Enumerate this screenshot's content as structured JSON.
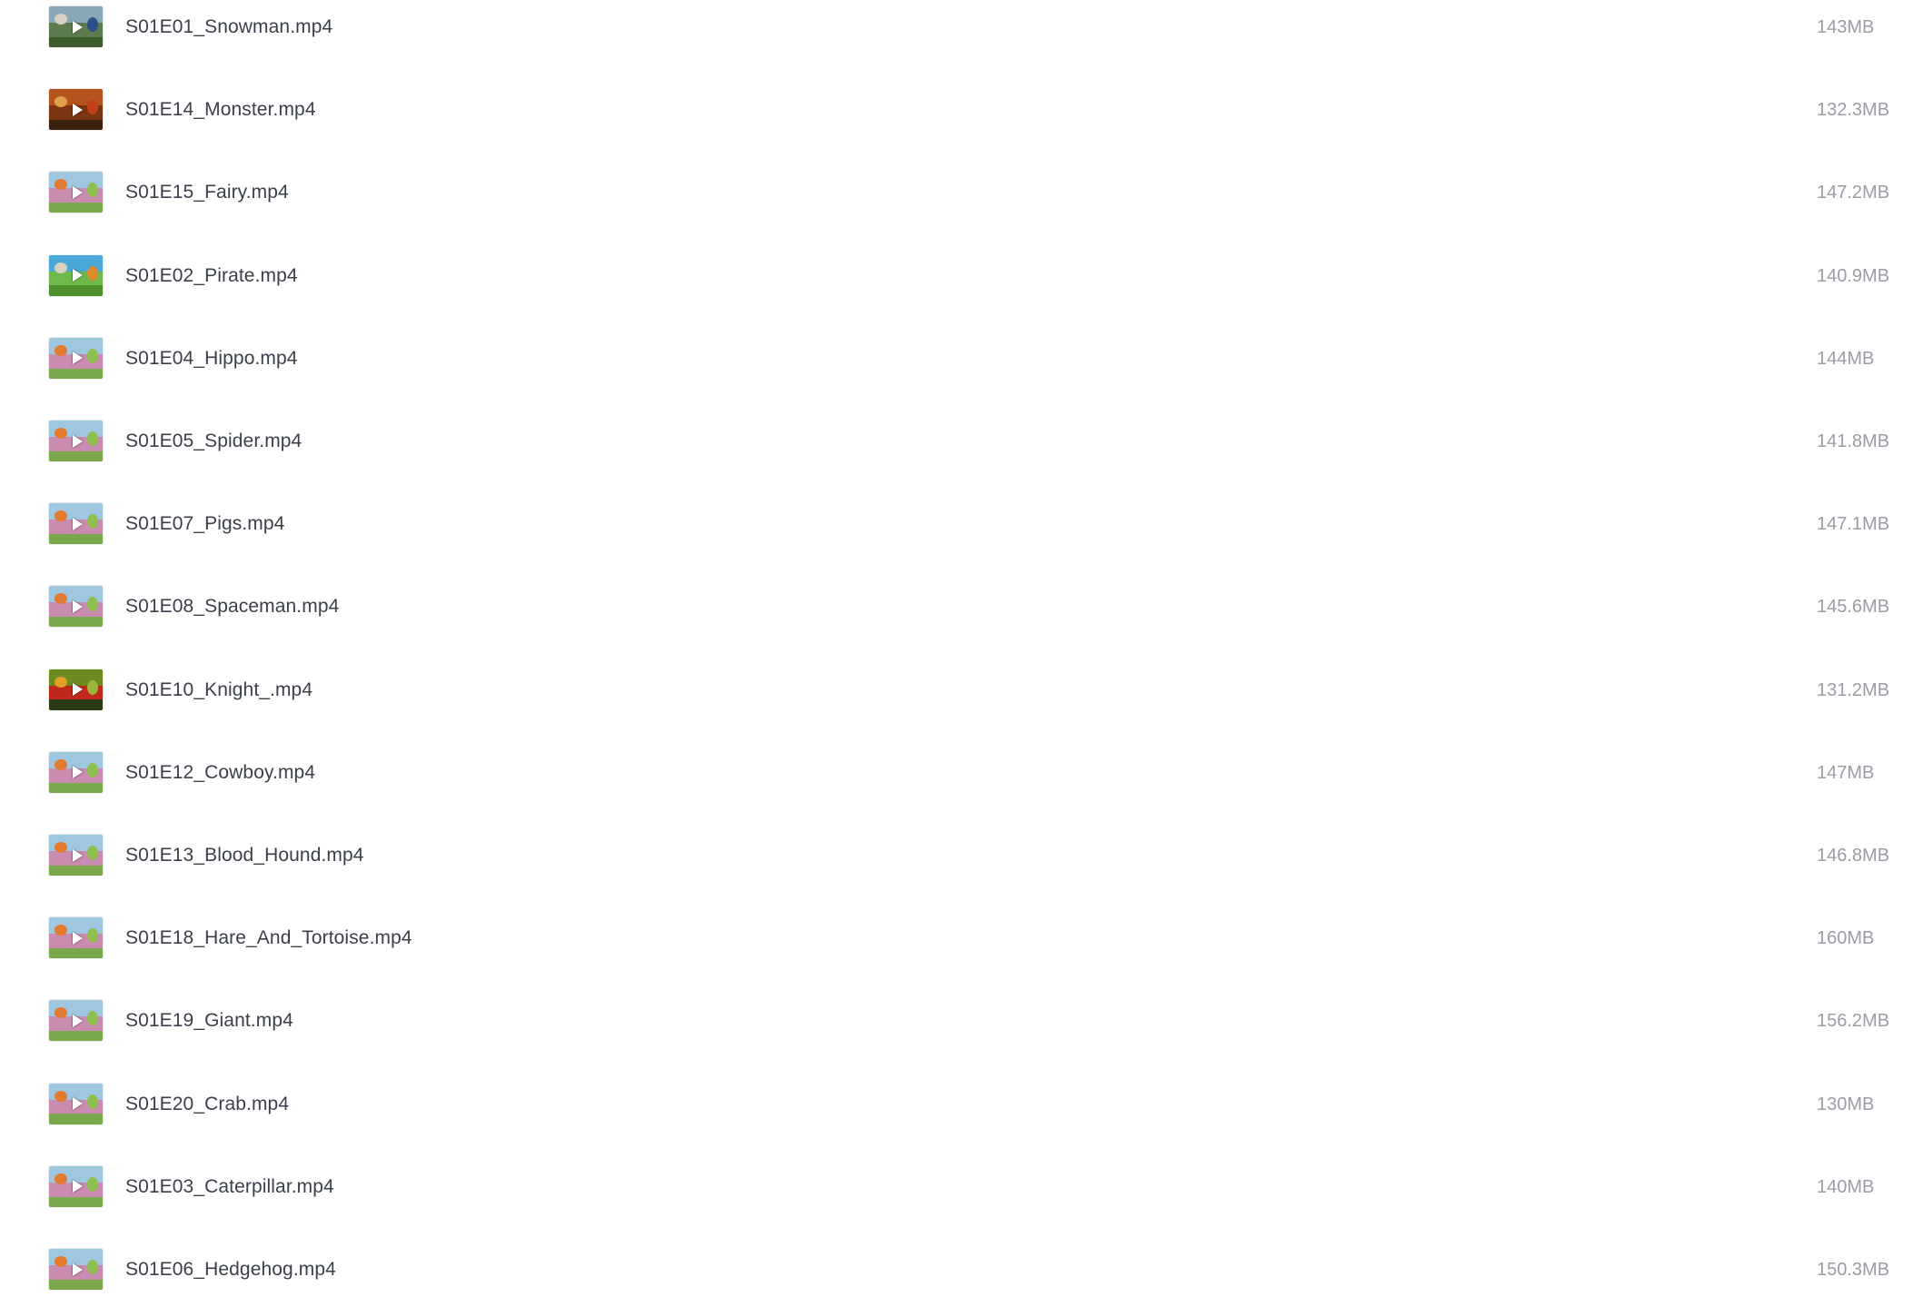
{
  "files": [
    {
      "name": "S01E01_Snowman.mp4",
      "size": "143MB",
      "icon": "play-icon",
      "thumb": {
        "sky": "#8aa7b8",
        "mid": "#5d7a4e",
        "ground": "#3c5a2c",
        "a": "#d8d0c4",
        "b": "#2b4f8a"
      }
    },
    {
      "name": "S01E14_Monster.mp4",
      "size": "132.3MB",
      "icon": "play-icon",
      "thumb": {
        "sky": "#b4531d",
        "mid": "#7a3412",
        "ground": "#3b2110",
        "a": "#e3a04a",
        "b": "#c2401b"
      }
    },
    {
      "name": "S01E15_Fairy.mp4",
      "size": "147.2MB",
      "icon": "play-icon",
      "thumb": {
        "sky": "#9fc7df",
        "mid": "#c98bb0",
        "ground": "#7aa84c",
        "a": "#e27a2f",
        "b": "#8fbf4d"
      }
    },
    {
      "name": "S01E02_Pirate.mp4",
      "size": "140.9MB",
      "icon": "play-icon",
      "thumb": {
        "sky": "#49a8d8",
        "mid": "#6fb84a",
        "ground": "#4f8f2d",
        "a": "#d9d2bf",
        "b": "#e08a2e"
      }
    },
    {
      "name": "S01E04_Hippo.mp4",
      "size": "144MB",
      "icon": "play-icon",
      "thumb": {
        "sky": "#9fc7df",
        "mid": "#c98bb0",
        "ground": "#7aa84c",
        "a": "#e27a2f",
        "b": "#8fbf4d"
      }
    },
    {
      "name": "S01E05_Spider.mp4",
      "size": "141.8MB",
      "icon": "play-icon",
      "thumb": {
        "sky": "#9fc7df",
        "mid": "#c98bb0",
        "ground": "#7aa84c",
        "a": "#e27a2f",
        "b": "#8fbf4d"
      }
    },
    {
      "name": "S01E07_Pigs.mp4",
      "size": "147.1MB",
      "icon": "play-icon",
      "thumb": {
        "sky": "#9fc7df",
        "mid": "#c98bb0",
        "ground": "#7aa84c",
        "a": "#e27a2f",
        "b": "#8fbf4d"
      }
    },
    {
      "name": "S01E08_Spaceman.mp4",
      "size": "145.6MB",
      "icon": "play-icon",
      "thumb": {
        "sky": "#9fc7df",
        "mid": "#c98bb0",
        "ground": "#7aa84c",
        "a": "#e27a2f",
        "b": "#8fbf4d"
      }
    },
    {
      "name": "S01E10_Knight_.mp4",
      "size": "131.2MB",
      "icon": "play-icon",
      "thumb": {
        "sky": "#6b8a1f",
        "mid": "#c0281c",
        "ground": "#2a3a14",
        "a": "#e0a025",
        "b": "#9bb53a"
      }
    },
    {
      "name": "S01E12_Cowboy.mp4",
      "size": "147MB",
      "icon": "play-icon",
      "thumb": {
        "sky": "#9fc7df",
        "mid": "#c98bb0",
        "ground": "#7aa84c",
        "a": "#e27a2f",
        "b": "#8fbf4d"
      }
    },
    {
      "name": "S01E13_Blood_Hound.mp4",
      "size": "146.8MB",
      "icon": "play-icon",
      "thumb": {
        "sky": "#9fc7df",
        "mid": "#c98bb0",
        "ground": "#7aa84c",
        "a": "#e27a2f",
        "b": "#8fbf4d"
      }
    },
    {
      "name": "S01E18_Hare_And_Tortoise.mp4",
      "size": "160MB",
      "icon": "play-icon",
      "thumb": {
        "sky": "#9fc7df",
        "mid": "#c98bb0",
        "ground": "#7aa84c",
        "a": "#e27a2f",
        "b": "#8fbf4d"
      }
    },
    {
      "name": "S01E19_Giant.mp4",
      "size": "156.2MB",
      "icon": "play-icon",
      "thumb": {
        "sky": "#9fc7df",
        "mid": "#c98bb0",
        "ground": "#7aa84c",
        "a": "#e27a2f",
        "b": "#8fbf4d"
      }
    },
    {
      "name": "S01E20_Crab.mp4",
      "size": "130MB",
      "icon": "play-icon",
      "thumb": {
        "sky": "#9fc7df",
        "mid": "#c98bb0",
        "ground": "#7aa84c",
        "a": "#e27a2f",
        "b": "#8fbf4d"
      }
    },
    {
      "name": "S01E03_Caterpillar.mp4",
      "size": "140MB",
      "icon": "play-icon",
      "thumb": {
        "sky": "#9fc7df",
        "mid": "#c98bb0",
        "ground": "#7aa84c",
        "a": "#e27a2f",
        "b": "#8fbf4d"
      }
    },
    {
      "name": "S01E06_Hedgehog.mp4",
      "size": "150.3MB",
      "icon": "play-icon",
      "thumb": {
        "sky": "#9fc7df",
        "mid": "#c98bb0",
        "ground": "#7aa84c",
        "a": "#e27a2f",
        "b": "#8fbf4d"
      }
    }
  ]
}
